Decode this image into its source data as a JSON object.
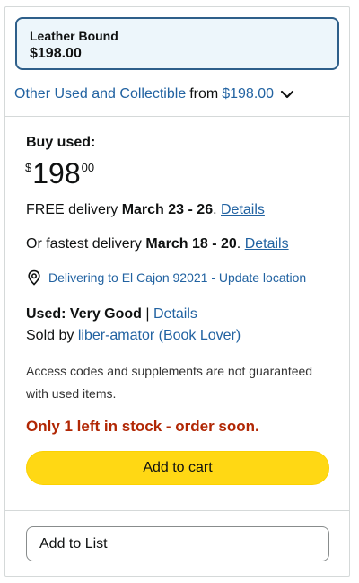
{
  "format": {
    "name": "Leather Bound",
    "price": "$198.00"
  },
  "other_used": {
    "label": "Other Used and Collectible",
    "from_text": "from",
    "price": "$198.00"
  },
  "buy_used": {
    "heading": "Buy used:",
    "price_symbol": "$",
    "price_whole": "198",
    "price_fraction": "00"
  },
  "delivery": {
    "free_prefix": "FREE delivery",
    "free_dates": "March 23 - 26",
    "free_suffix": ".",
    "free_details": "Details",
    "fast_prefix": "Or fastest delivery",
    "fast_dates": "March 18 - 20",
    "fast_suffix": ".",
    "fast_details": "Details"
  },
  "location": {
    "text": "Delivering to El Cajon 92021 - Update location"
  },
  "condition": {
    "label": "Used: Very Good",
    "separator": "|",
    "details": "Details"
  },
  "seller": {
    "prefix": "Sold by",
    "name": "liber-amator (Book Lover)"
  },
  "note": "Access codes and supplements are not guaranteed with used items.",
  "stock": "Only 1 left in stock - order soon.",
  "buttons": {
    "add_to_cart": "Add to cart",
    "add_to_list": "Add to List"
  },
  "colors": {
    "link": "#2162a1",
    "cart_button": "#ffd814",
    "stock_warning": "#b12704",
    "selected_border": "#2e5f8a"
  }
}
